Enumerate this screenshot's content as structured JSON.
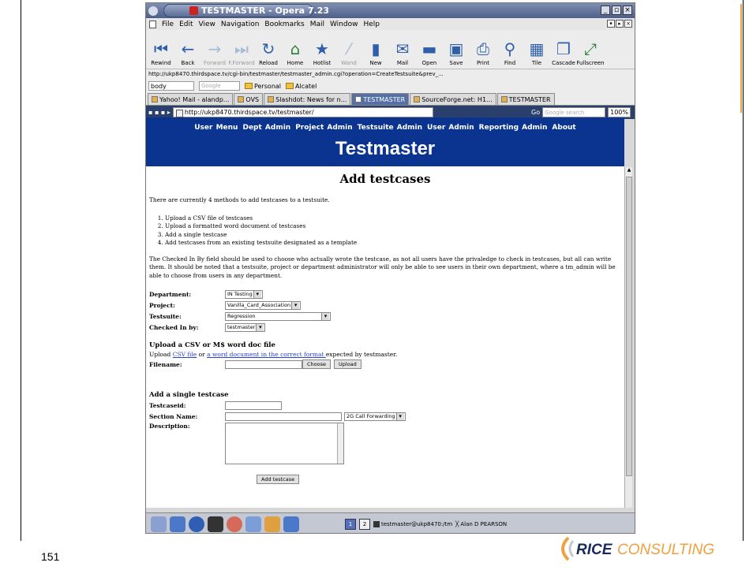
{
  "slide": {
    "number": "151",
    "logo_text": "RICECONSULTING",
    "accent_color": "#f0a040"
  },
  "window": {
    "title": "TESTMASTER - Opera 7.23"
  },
  "menus": [
    "File",
    "Edit",
    "View",
    "Navigation",
    "Bookmarks",
    "Mail",
    "Window",
    "Help"
  ],
  "toolbar": [
    {
      "label": "Rewind",
      "icon": "rewind-icon",
      "glyph": "⏮",
      "enabled": true
    },
    {
      "label": "Back",
      "icon": "back-arrow-icon",
      "glyph": "←",
      "enabled": true
    },
    {
      "label": "Forward",
      "icon": "forward-arrow-icon",
      "glyph": "→",
      "enabled": false
    },
    {
      "label": "F.Forward",
      "icon": "fast-forward-icon",
      "glyph": "⏭",
      "enabled": false
    },
    {
      "label": "Reload",
      "icon": "reload-icon",
      "glyph": "↻",
      "enabled": true
    },
    {
      "label": "Home",
      "icon": "home-icon",
      "glyph": "⌂",
      "enabled": true,
      "green": true
    },
    {
      "label": "Hotlist",
      "icon": "star-icon",
      "glyph": "★",
      "enabled": true
    },
    {
      "label": "Wand",
      "icon": "wand-icon",
      "glyph": "⁄",
      "enabled": false
    },
    {
      "label": "New",
      "icon": "new-page-icon",
      "glyph": "▮",
      "enabled": true
    },
    {
      "label": "Mail",
      "icon": "mail-icon",
      "glyph": "✉",
      "enabled": true
    },
    {
      "label": "Open",
      "icon": "open-folder-icon",
      "glyph": "▬",
      "enabled": true
    },
    {
      "label": "Save",
      "icon": "save-icon",
      "glyph": "▣",
      "enabled": true
    },
    {
      "label": "Print",
      "icon": "print-icon",
      "glyph": "⎙",
      "enabled": true
    },
    {
      "label": "Find",
      "icon": "find-icon",
      "glyph": "⚲",
      "enabled": true
    },
    {
      "label": "Tile",
      "icon": "tile-icon",
      "glyph": "▦",
      "enabled": true
    },
    {
      "label": "Cascade",
      "icon": "cascade-icon",
      "glyph": "❐",
      "enabled": true
    },
    {
      "label": "Fullscreen",
      "icon": "fullscreen-icon",
      "glyph": "⤢",
      "enabled": true,
      "green": true
    }
  ],
  "address_line": "http://ukp8470.thirdspace.tv/cgi-bin/testmaster/testmaster_admin.cgi?operation=CreateTestsuite&prev_...",
  "bookmarks_bar": {
    "field_value": "body",
    "google_placeholder": "Google groups",
    "folders": [
      "Personal",
      "Alcatel"
    ]
  },
  "tabs": [
    {
      "label": "Yahoo! Mail - alandp...",
      "active": false
    },
    {
      "label": "OVS",
      "active": false
    },
    {
      "label": "Slashdot: News for n...",
      "active": false
    },
    {
      "label": "TESTMASTER",
      "active": true
    },
    {
      "label": "SourceForge.net: H1...",
      "active": false
    },
    {
      "label": "TESTMASTER",
      "active": false
    }
  ],
  "url_bar": {
    "url": "http://ukp8470.thirdspace.tv/testmaster/",
    "go_label": "Go",
    "search_placeholder": "Google search",
    "zoom": "100%"
  },
  "site": {
    "nav": [
      "User Menu",
      "Dept Admin",
      "Project Admin",
      "Testsuite Admin",
      "User Admin",
      "Reporting Admin",
      "About"
    ],
    "title": "Testmaster"
  },
  "page": {
    "heading": "Add testcases",
    "intro": "There are currently 4 methods to add testcases to a testsuite.",
    "methods": [
      "Upload a CSV file of testcases",
      "Upload a formatted word document of testcases",
      "Add a single testcase",
      "Add testcases from an existing testsuite designated as a template"
    ],
    "note": "The Checked In By field should be used to choose who actually wrote the testcase, as not all users have the privaledge to check in testcases, but all can write them. It should be noted that a testsuite, project or department administrator will only be able to see users in their own department, where a tm_admin will be able to choose from users in any department.",
    "fields": [
      {
        "label": "Department:",
        "value": "IN Testing"
      },
      {
        "label": "Project:",
        "value": "Vanilla_Card_Association"
      },
      {
        "label": "Testsuite:",
        "value": "Regression"
      },
      {
        "label": "Checked In by:",
        "value": "testmaster"
      }
    ],
    "upload_section": {
      "heading": "Upload a CSV or M$ word doc file",
      "text_prefix": "Upload ",
      "csv_link": "CSV file",
      "text_or": " or ",
      "word_link": "a word document in the correct format ",
      "text_suffix": "expected by testmaster.",
      "filename_label": "Filename:",
      "choose_label": "Choose",
      "upload_label": "Upload"
    },
    "single_section": {
      "heading": "Add a single testcase",
      "testcaseid_label": "Testcaseid:",
      "section_label": "Section Name:",
      "section_select": "2G Call Forwarding",
      "description_label": "Description:",
      "submit_label": "Add testcase"
    }
  },
  "taskbar": {
    "workspaces": [
      "1",
      "2"
    ],
    "tasks": [
      "testmaster@ukp8470:/tm",
      "Alan D PEARSON"
    ]
  }
}
